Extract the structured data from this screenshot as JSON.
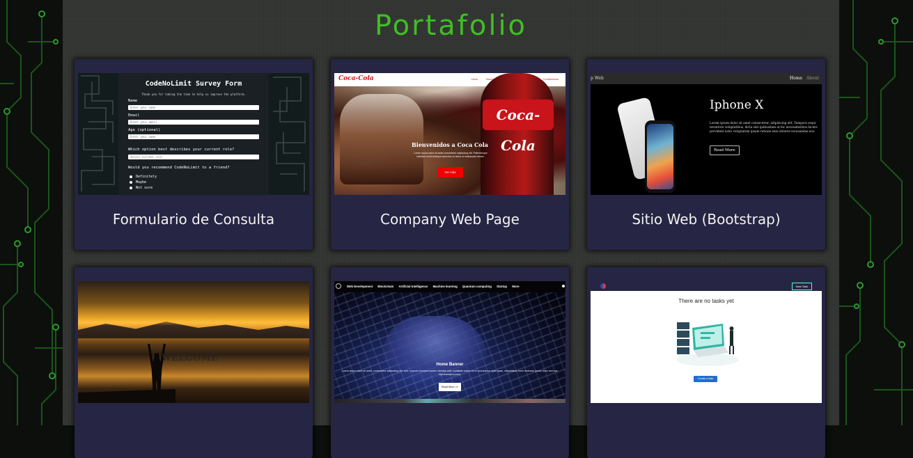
{
  "page": {
    "title": "Portafolio"
  },
  "projects": [
    {
      "label": "Formulario de Consulta",
      "thumb": {
        "form_title": "CodeNoLimit Survey Form",
        "form_desc": "Thank you for taking the time to help us improve the platform.",
        "name_label": "Name",
        "name_placeholder": "Enter your name",
        "email_label": "Email",
        "email_placeholder": "Enter your email",
        "age_label": "Age (optional)",
        "age_placeholder": "Enter your name",
        "role_question": "Which option best describes your current role?",
        "role_select": "Select current role",
        "recommend_question": "Would you recommend CodeNoLimit to a friend?",
        "options": [
          "Definitely",
          "Maybe",
          "Not sure"
        ]
      }
    },
    {
      "label": "Company Web Page",
      "thumb": {
        "logo": "Coca-Cola",
        "nav": [
          "Inicio",
          "Nosotros",
          "Servicios",
          "Galeria",
          "Contactanos"
        ],
        "hero_title": "Bienvenidos a Coca Cola",
        "hero_text": "Lorem ipsum dolor sit amet consectetur adipiscing elit. Pellentesque habitant morbi tristique senectus et netus et malesuada fames.",
        "bottle_label": "Coca-Cola",
        "button": "Ver más"
      }
    },
    {
      "label": "Sitio Web (Bootstrap)",
      "thumb": {
        "brand": "p Web",
        "nav": [
          "Home",
          "About"
        ],
        "product_title": "Iphone X",
        "product_text": "Lorem ipsum dolor sit amet consectetur, adipisicing elit. Tempora sequi inventore voluptatibus, dicta sint quibusdam at hic necessitatibus facere provident iusto voluptatem ipsum ratione esse dolores recusandae eos.",
        "button": "Read More"
      }
    },
    {
      "label": "",
      "thumb": {
        "welcome": "WELCOME"
      }
    },
    {
      "label": "",
      "thumb": {
        "nav": [
          "Web Development",
          "Blockchain",
          "Artificial Intelligence",
          "Machine learning",
          "Quantum computing",
          "Startup",
          "More"
        ],
        "banner_title": "Home Banner",
        "banner_text": "Lorem ipsum dolor sit amet, consectetur adipisicing elit. Iure, corporis excepturi autem veritatis ante cupiditate harum error accusamus optio quae, voluptatibus fuere distinctio ipsam dolor sed eos, reprehenderit porro.",
        "button": "Read More >>"
      }
    },
    {
      "label": "",
      "thumb": {
        "new_task": "New Task",
        "empty_text": "There are no tasks yet",
        "button": "Create a task"
      }
    }
  ],
  "colors": {
    "title": "#3fbf22",
    "card": "#262543",
    "panel": "#333533",
    "circuit": "#2f9a2f"
  }
}
